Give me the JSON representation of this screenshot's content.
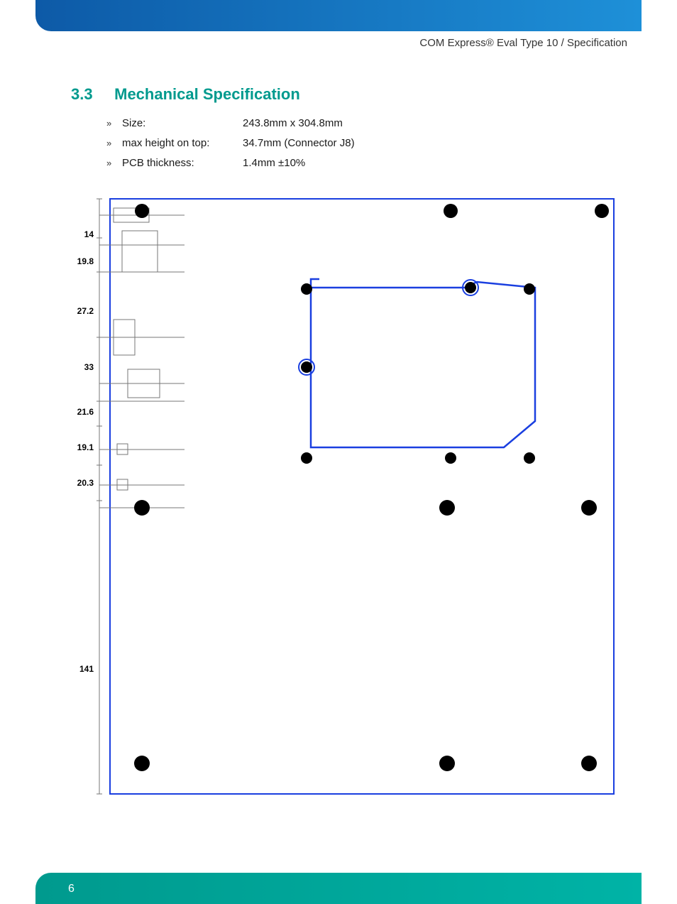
{
  "header": {
    "breadcrumb": "COM Express® Eval Type 10 / Specification"
  },
  "section": {
    "number": "3.3",
    "title": "Mechanical Specification"
  },
  "specs": [
    {
      "label": "Size:",
      "value": "243.8mm x 304.8mm"
    },
    {
      "label": "max height on top:",
      "value": "34.7mm (Connector J8)"
    },
    {
      "label": "PCB thickness:",
      "value": "1.4mm ±10%"
    }
  ],
  "diagram": {
    "dimension_labels": [
      "14",
      "19.8",
      "27.2",
      "33",
      "21.6",
      "19.1",
      "20.3",
      "141"
    ]
  },
  "footer": {
    "page_number": "6"
  }
}
